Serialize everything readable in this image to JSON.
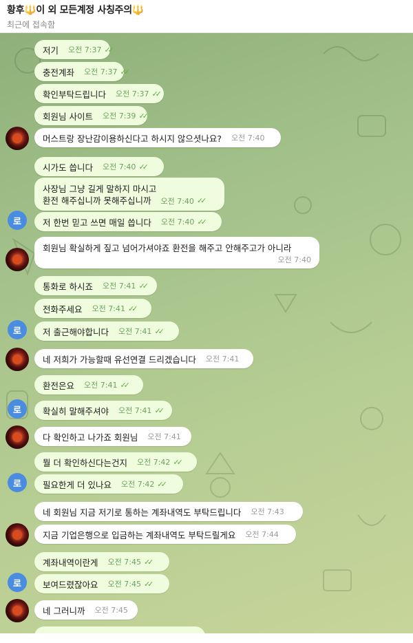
{
  "header": {
    "title_pre": "황후",
    "title_mid": "이 외 모든계정 사칭주의",
    "trident_glyph": "🔱",
    "subtitle": "최근에 접속함"
  },
  "avatar_initial": "로",
  "messages": [
    {
      "text": "저기",
      "time": "오전 7:37",
      "dir": "out"
    },
    {
      "text": "충전계좌",
      "time": "오전 7:37",
      "dir": "out"
    },
    {
      "text": "확인부탁드립니다",
      "time": "오전 7:37",
      "dir": "out"
    },
    {
      "text": "회원님 사이트",
      "time": "오전 7:39",
      "dir": "out"
    },
    {
      "text": "머스트랑 장난감이용하신다고 하시지 않으셧나요?",
      "time": "오전 7:40",
      "dir": "in"
    },
    {
      "text": "시가도 씁니다",
      "time": "오전 7:40",
      "dir": "out"
    },
    {
      "text_line1": "사장님 그냥 길게 말하지 마시고",
      "text_line2": "환전 해주십니까 못해주십니까",
      "time": "오전 7:40",
      "dir": "out"
    },
    {
      "text": "저 한번 믿고 쓰면 매일 씁니다",
      "time": "오전 7:40",
      "dir": "out"
    },
    {
      "text": "회원님 확실하게 짚고 넘어가셔야죠 환전을 해주고 안해주고가 아니라",
      "time": "오전 7:40",
      "dir": "in"
    },
    {
      "text": "통화로 하시죠",
      "time": "오전 7:41",
      "dir": "out"
    },
    {
      "text": "전화주세요",
      "time": "오전 7:41",
      "dir": "out"
    },
    {
      "text": "저 출근해야합니다",
      "time": "오전 7:41",
      "dir": "out"
    },
    {
      "text": "네 저희가 가능할때 유선연결 드리겠습니다",
      "time": "오전 7:41",
      "dir": "in"
    },
    {
      "text": "환전은요",
      "time": "오전 7:41",
      "dir": "out"
    },
    {
      "text": "확실히 말해주셔야",
      "time": "오전 7:41",
      "dir": "out"
    },
    {
      "text": "다 확인하고 나가죠 회원님",
      "time": "오전 7:41",
      "dir": "in"
    },
    {
      "text": "뭘 더 확인하신다는건지",
      "time": "오전 7:42",
      "dir": "out"
    },
    {
      "text": "필요한게 더 있나요",
      "time": "오전 7:42",
      "dir": "out"
    },
    {
      "text": "네 회원님 지금 저기로 통하는 계좌내역도 부탁드립니다",
      "time": "오전 7:43",
      "dir": "in"
    },
    {
      "text": "지금 기업은행으로 입금하는 계좌내역도 부탁드릴게요",
      "time": "오전 7:44",
      "dir": "in"
    },
    {
      "text": "계좌내역이란게",
      "time": "오전 7:45",
      "dir": "out"
    },
    {
      "text": "보여드렸잖아요",
      "time": "오전 7:45",
      "dir": "out"
    },
    {
      "text": "네 그러니까",
      "time": "오전 7:45",
      "dir": "in"
    }
  ],
  "colors": {
    "incoming_bubble": "#ffffff",
    "outgoing_bubble": "#effdde",
    "read_check": "#5dad3f",
    "avatar_blue": "#4a8de0"
  }
}
